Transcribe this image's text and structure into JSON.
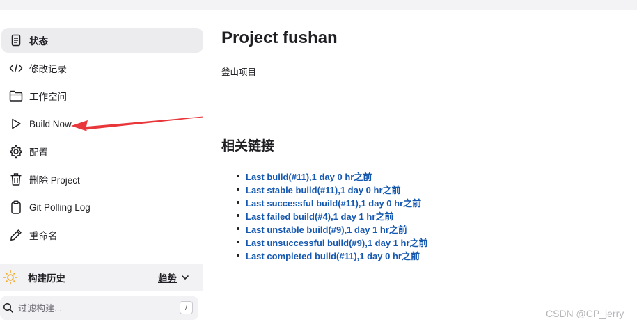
{
  "sidebar": {
    "items": [
      {
        "label": "状态",
        "icon": "document-icon"
      },
      {
        "label": "修改记录",
        "icon": "code-icon"
      },
      {
        "label": "工作空间",
        "icon": "folder-icon"
      },
      {
        "label": "Build Now",
        "icon": "play-icon"
      },
      {
        "label": "配置",
        "icon": "gear-icon"
      },
      {
        "label": "删除 Project",
        "icon": "trash-icon"
      },
      {
        "label": "Git Polling Log",
        "icon": "clipboard-icon"
      },
      {
        "label": "重命名",
        "icon": "pencil-icon"
      }
    ]
  },
  "build_history": {
    "title": "构建历史",
    "trend_label": "趋势",
    "filter_placeholder": "过滤构建...",
    "shortcut_key": "/"
  },
  "main": {
    "title": "Project fushan",
    "description": "釜山项目",
    "links_heading": "相关链接",
    "links": [
      "Last build(#11),1 day 0 hr之前",
      "Last stable build(#11),1 day 0 hr之前",
      "Last successful build(#11),1 day 0 hr之前",
      "Last failed build(#4),1 day 1 hr之前",
      "Last unstable build(#9),1 day 1 hr之前",
      "Last unsuccessful build(#9),1 day 1 hr之前",
      "Last completed build(#11),1 day 0 hr之前"
    ]
  },
  "watermark": "CSDN @CP_jerry",
  "colors": {
    "link": "#1558b0",
    "active_bg": "#ececef",
    "annotation_arrow": "#e8363a",
    "sun": "#f4a927"
  }
}
